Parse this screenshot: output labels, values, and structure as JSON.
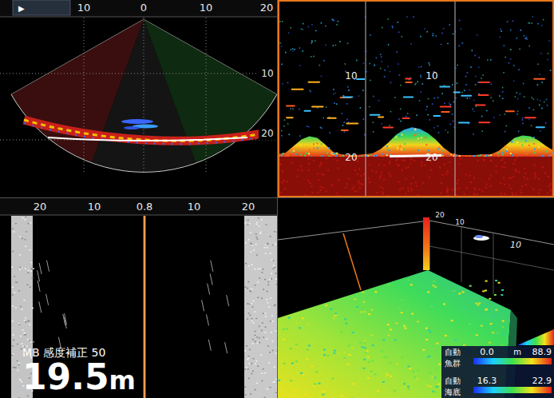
{
  "scan_panel": {
    "play_button": "▶",
    "range_ticks": [
      "10",
      "0",
      "10",
      "20"
    ],
    "depth_ticks": [
      "10",
      "20"
    ]
  },
  "echo_panel": {
    "selected": true,
    "columns": [
      {
        "depth_ticks": [
          "10",
          "20"
        ]
      },
      {
        "depth_ticks": [
          "10",
          "20"
        ]
      },
      {
        "depth_ticks": []
      }
    ],
    "bottom_profile": [
      19.6,
      19.4,
      18.6,
      17.8,
      17.4,
      17.6,
      18.4,
      19.3,
      19.6,
      19.7,
      19.7,
      19.6,
      19.5,
      19.0,
      18.2,
      17.2,
      16.6,
      16.3,
      16.5,
      17.0,
      17.8,
      18.8,
      19.5,
      19.7,
      19.7,
      19.7,
      19.6,
      19.6,
      19.2,
      18.4,
      17.6,
      17.3,
      17.4,
      17.9,
      18.6,
      19.2
    ]
  },
  "side_scan_panel": {
    "range_ticks": [
      "20",
      "10",
      "0.8",
      "10",
      "20"
    ],
    "gain_label": "MB 感度補正 50",
    "depth": "19.5",
    "depth_unit": "m"
  },
  "view_3d_panel": {
    "axis_labels": [
      "20",
      "10",
      "10"
    ],
    "legend": [
      {
        "mode": "自動",
        "name": "魚群",
        "min": "0.0",
        "unit": "m",
        "max": "88.9"
      },
      {
        "mode": "自動",
        "name": "海底",
        "min": "16.3",
        "max": "22.9"
      }
    ]
  }
}
